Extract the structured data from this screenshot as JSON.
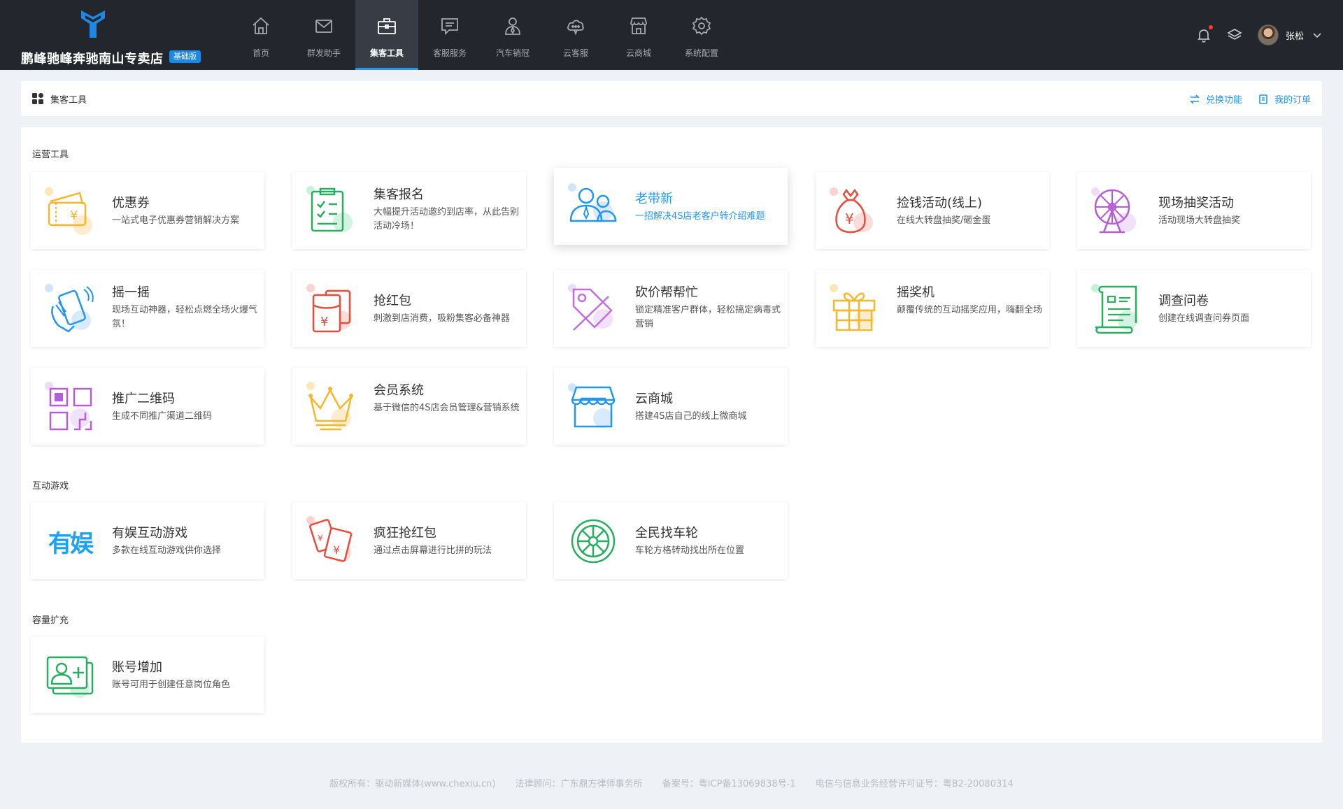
{
  "brand": {
    "name": "鹏峰驰峰奔驰南山专卖店",
    "badge": "基础版"
  },
  "nav": [
    {
      "label": "首页",
      "icon": "home-icon"
    },
    {
      "label": "群发助手",
      "icon": "mail-icon"
    },
    {
      "label": "集客工具",
      "icon": "briefcase-icon",
      "active": true
    },
    {
      "label": "客服服务",
      "icon": "chat-icon"
    },
    {
      "label": "汽车销冠",
      "icon": "salesperson-icon"
    },
    {
      "label": "云客服",
      "icon": "cloud-service-icon"
    },
    {
      "label": "云商城",
      "icon": "store-icon"
    },
    {
      "label": "系统配置",
      "icon": "gear-icon"
    }
  ],
  "user": {
    "name": "张松"
  },
  "breadcrumb": {
    "title": "集客工具",
    "exchange": "兑换功能",
    "orders": "我的订单"
  },
  "sections": {
    "ops": "运营工具",
    "games": "互动游戏",
    "capacity": "容量扩充"
  },
  "cards": {
    "coupon": {
      "title": "优惠券",
      "desc": "一站式电子优惠券营销解决方案"
    },
    "signup": {
      "title": "集客报名",
      "desc": "大幅提升活动邀约到店率，从此告别活动冷场！"
    },
    "referral": {
      "title": "老带新",
      "desc": "一招解决4S店老客户转介绍难题"
    },
    "money": {
      "title": "捡钱活动(线上)",
      "desc": "在线大转盘抽奖/砸金蛋"
    },
    "lottery": {
      "title": "现场抽奖活动",
      "desc": "活动现场大转盘抽奖"
    },
    "shake": {
      "title": "摇一摇",
      "desc": "现场互动神器，轻松点燃全场火爆气氛！"
    },
    "redpacket": {
      "title": "抢红包",
      "desc": "刺激到店消费，吸粉集客必备神器"
    },
    "bargain": {
      "title": "砍价帮帮忙",
      "desc": "锁定精准客户群体，轻松搞定病毒式营销"
    },
    "prizemachine": {
      "title": "摇奖机",
      "desc": "颠覆传统的互动摇奖应用，嗨翻全场"
    },
    "survey": {
      "title": "调查问卷",
      "desc": "创建在线调查问券页面"
    },
    "qrcode": {
      "title": "推广二维码",
      "desc": "生成不同推广渠道二维码"
    },
    "member": {
      "title": "会员系统",
      "desc": "基于微信的4S店会员管理&营销系统"
    },
    "mall": {
      "title": "云商城",
      "desc": "搭建4S店自己的线上微商城"
    },
    "youyu": {
      "title": "有娱互动游戏",
      "desc": "多款在线互动游戏供你选择",
      "logo_text": "有娱"
    },
    "crazyred": {
      "title": "疯狂抢红包",
      "desc": "通过点击屏幕进行比拼的玩法"
    },
    "wheel": {
      "title": "全民找车轮",
      "desc": "车轮方格转动找出所在位置"
    },
    "account": {
      "title": "账号增加",
      "desc": "账号可用于创建任意岗位角色"
    }
  },
  "footer": {
    "copyright": "版权所有：驱动新媒体(www.chexiu.cn)",
    "legal": "法律顾问：广东鼎方律师事务所",
    "icp": "备案号：粤ICP备13069838号-1",
    "license": "电信与信息业务经营许可证号：粤B2-20080314"
  },
  "colors": {
    "accent": "#2196f3",
    "topbar": "#23262d"
  }
}
